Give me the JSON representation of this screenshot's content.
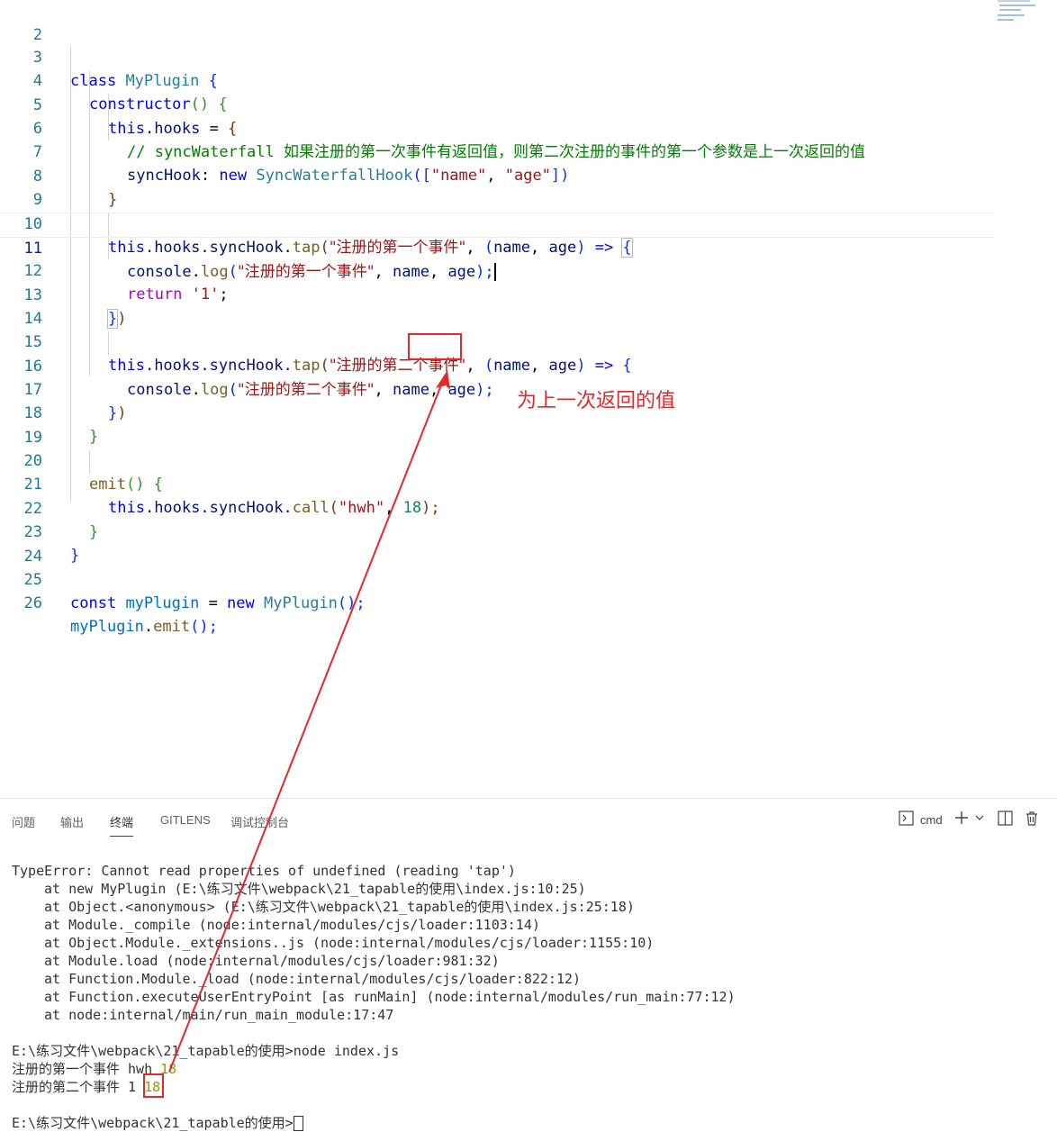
{
  "editor": {
    "active_line": 11,
    "lines": [
      {
        "num": "2"
      },
      {
        "num": "3",
        "t1": "class",
        "t2": "MyPlugin",
        "t3": "{"
      },
      {
        "num": "4",
        "t1": "constructor",
        "t2": "()",
        "t3": "{"
      },
      {
        "num": "5",
        "t1": "this",
        "t2": ".",
        "t3": "hooks",
        "t4": " = ",
        "t5": "{"
      },
      {
        "num": "6",
        "t1": "// syncWaterfall ",
        "t2": "如果注册的第一次事件有返回值，则第二次注册的事件的第一个参数是上一次返回的值"
      },
      {
        "num": "7",
        "t1": "syncHook",
        "t2": ": ",
        "t3": "new",
        "t4": "SyncWaterfallHook",
        "t5": "([",
        "t6": "\"name\"",
        "t7": ", ",
        "t8": "\"age\"",
        "t9": "])"
      },
      {
        "num": "8",
        "t1": "}"
      },
      {
        "num": "9"
      },
      {
        "num": "10",
        "t1": "this",
        "t2": ".hooks.syncHook.",
        "t3": "tap",
        "t4": "(",
        "t5": "\"注册的第一个事件\"",
        "t6": ", ",
        "t7": "(",
        "t8": "name",
        "t9": ", ",
        "t10": "age",
        "t11": ")",
        "t12": " => ",
        "t13": "{"
      },
      {
        "num": "11",
        "t1": "console",
        "t2": ".",
        "t3": "log",
        "t4": "(",
        "t5": "\"注册的第一个事件\"",
        "t6": ", ",
        "t7": "name",
        "t8": ", ",
        "t9": "age",
        "t10": ");"
      },
      {
        "num": "12",
        "t1": "return",
        "t2": " ",
        "t3": "'1'",
        "t4": ";"
      },
      {
        "num": "13",
        "t1": "}",
        "t2": ")"
      },
      {
        "num": "14"
      },
      {
        "num": "15",
        "t1": "this",
        "t2": ".hooks.syncHook.",
        "t3": "tap",
        "t4": "(",
        "t5": "\"注册的第二个事件\"",
        "t6": ", ",
        "t7": "(",
        "t8": "name",
        "t9": ", ",
        "t10": "age",
        "t11": ")",
        "t12": " => ",
        "t13": "{"
      },
      {
        "num": "16",
        "t1": "console",
        "t2": ".",
        "t3": "log",
        "t4": "(",
        "t5": "\"注册的第二个事件\"",
        "t6": ", ",
        "t7": "name",
        "t8": ", ",
        "t9": "age",
        "t10": ");"
      },
      {
        "num": "17",
        "t1": "}",
        "t2": ")"
      },
      {
        "num": "18",
        "t1": "}"
      },
      {
        "num": "19"
      },
      {
        "num": "20",
        "t1": "emit",
        "t2": "()",
        "t3": " {"
      },
      {
        "num": "21",
        "t1": "this",
        "t2": ".hooks.syncHook.",
        "t3": "call",
        "t4": "(",
        "t5": "\"hwh\"",
        "t6": ", ",
        "t7": "18",
        "t8": ");"
      },
      {
        "num": "22",
        "t1": "}"
      },
      {
        "num": "23",
        "t1": "}"
      },
      {
        "num": "24"
      },
      {
        "num": "25",
        "t1": "const",
        "t2": "myPlugin",
        "t3": " = ",
        "t4": "new",
        "t5": "MyPlugin",
        "t6": "();"
      },
      {
        "num": "26",
        "t1": "myPlugin",
        "t2": ".",
        "t3": "emit",
        "t4": "();"
      }
    ]
  },
  "annotation": {
    "label": "为上一次返回的值",
    "color": "#e8262c"
  },
  "panel": {
    "tabs": [
      "问题",
      "输出",
      "终端",
      "GITLENS",
      "调试控制台"
    ],
    "active_tab": "终端",
    "shell_label": "cmd",
    "icons": [
      "terminal-icon",
      "plus-icon",
      "chevron-down-icon",
      "split-icon",
      "trash-icon"
    ]
  },
  "terminal": {
    "error_head": "TypeError: Cannot read properties of undefined (reading 'tap')",
    "stack": [
      "at new MyPlugin (E:\\练习文件\\webpack\\21_tapable的使用\\index.js:10:25)",
      "at Object.<anonymous> (E:\\练习文件\\webpack\\21_tapable的使用\\index.js:25:18)",
      "at Module._compile (node:internal/modules/cjs/loader:1103:14)",
      "at Object.Module._extensions..js (node:internal/modules/cjs/loader:1155:10)",
      "at Module.load (node:internal/modules/cjs/loader:981:32)",
      "at Function.Module._load (node:internal/modules/cjs/loader:822:12)",
      "at Function.executeUserEntryPoint [as runMain] (node:internal/modules/run_main:77:12)",
      "at node:internal/main/run_main_module:17:47"
    ],
    "command": "E:\\练习文件\\webpack\\21_tapable的使用>node index.js",
    "out1_label": "注册的第一个事件 hwh",
    "out1_num": "18",
    "out2_label": "注册的第二个事件",
    "out2_value": "1",
    "out2_num": "18",
    "prompt": "E:\\练习文件\\webpack\\21_tapable的使用>"
  }
}
